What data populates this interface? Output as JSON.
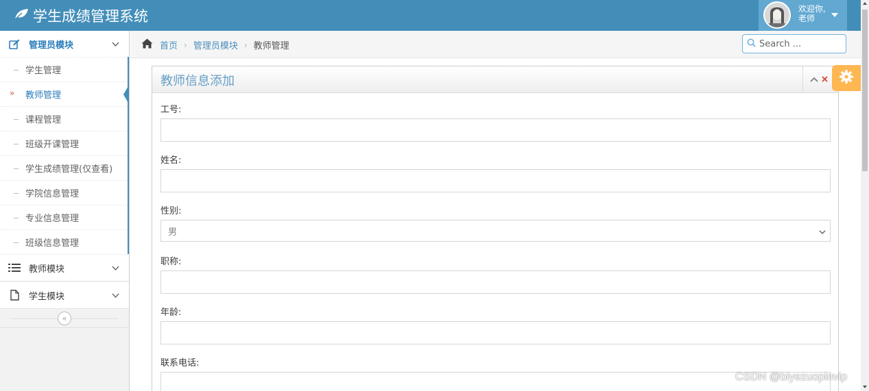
{
  "app": {
    "title": "学生成绩管理系统",
    "user_greeting": "欢迎你,",
    "user_name": "老师"
  },
  "sidebar": {
    "groups": [
      {
        "label": "管理员模块",
        "icon": "pencil-square-icon",
        "expanded": true,
        "items": [
          {
            "label": "学生管理"
          },
          {
            "label": "教师管理",
            "active": true
          },
          {
            "label": "课程管理"
          },
          {
            "label": "班级开课管理"
          },
          {
            "label": "学生成绩管理(仅查看)"
          },
          {
            "label": "学院信息管理"
          },
          {
            "label": "专业信息管理"
          },
          {
            "label": "班级信息管理"
          }
        ]
      },
      {
        "label": "教师模块",
        "icon": "list-icon",
        "expanded": false
      },
      {
        "label": "学生模块",
        "icon": "file-icon",
        "expanded": false
      }
    ],
    "collapse_glyph": "«"
  },
  "breadcrumbs": {
    "home": "首页",
    "section": "管理员模块",
    "current": "教师管理"
  },
  "search": {
    "placeholder": "Search ..."
  },
  "widget": {
    "title": "教师信息添加",
    "fields": [
      {
        "label": "工号:",
        "value": ""
      },
      {
        "label": "姓名:",
        "value": ""
      },
      {
        "label": "性别:",
        "value": "男",
        "type": "select"
      },
      {
        "label": "职称:",
        "value": ""
      },
      {
        "label": "年龄:",
        "value": ""
      },
      {
        "label": "联系电话:",
        "value": ""
      }
    ]
  },
  "watermark": "CSDN @biyezuopinvip",
  "colors": {
    "navbar": "#438eb9",
    "user_box": "#62a8d1",
    "accent_link": "#2b7dbc",
    "settings": "#ffb752",
    "close": "#d15b47"
  }
}
